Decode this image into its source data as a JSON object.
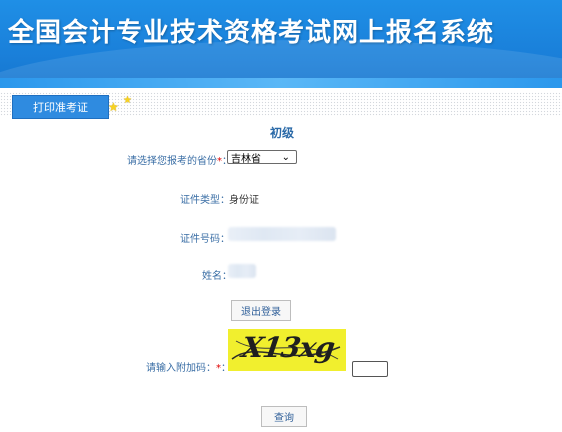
{
  "header": {
    "title": "全国会计专业技术资格考试网上报名系统"
  },
  "nav": {
    "tab_label": "打印准考证"
  },
  "form": {
    "level": "初级",
    "province_label": "请选择您报考的省份",
    "province_required": "*",
    "province_colon": "：",
    "province_value": "吉林省",
    "id_type_label": "证件类型：",
    "id_type_value": "身份证",
    "id_number_label": "证件号码：",
    "name_label": "姓名：",
    "logout_button": "退出登录",
    "captcha_label": "请输入附加码：",
    "captcha_required": "*",
    "captcha_colon": "：",
    "captcha_image_text": "X13xg",
    "query_button": "查询"
  },
  "colors": {
    "banner": "#1a80da",
    "tab": "#2f8be0",
    "label": "#3a6ea5",
    "required": "#e00000",
    "captcha_bg": "#f1ef2e"
  },
  "icons": [
    "star-icon",
    "chevron-down-icon"
  ]
}
